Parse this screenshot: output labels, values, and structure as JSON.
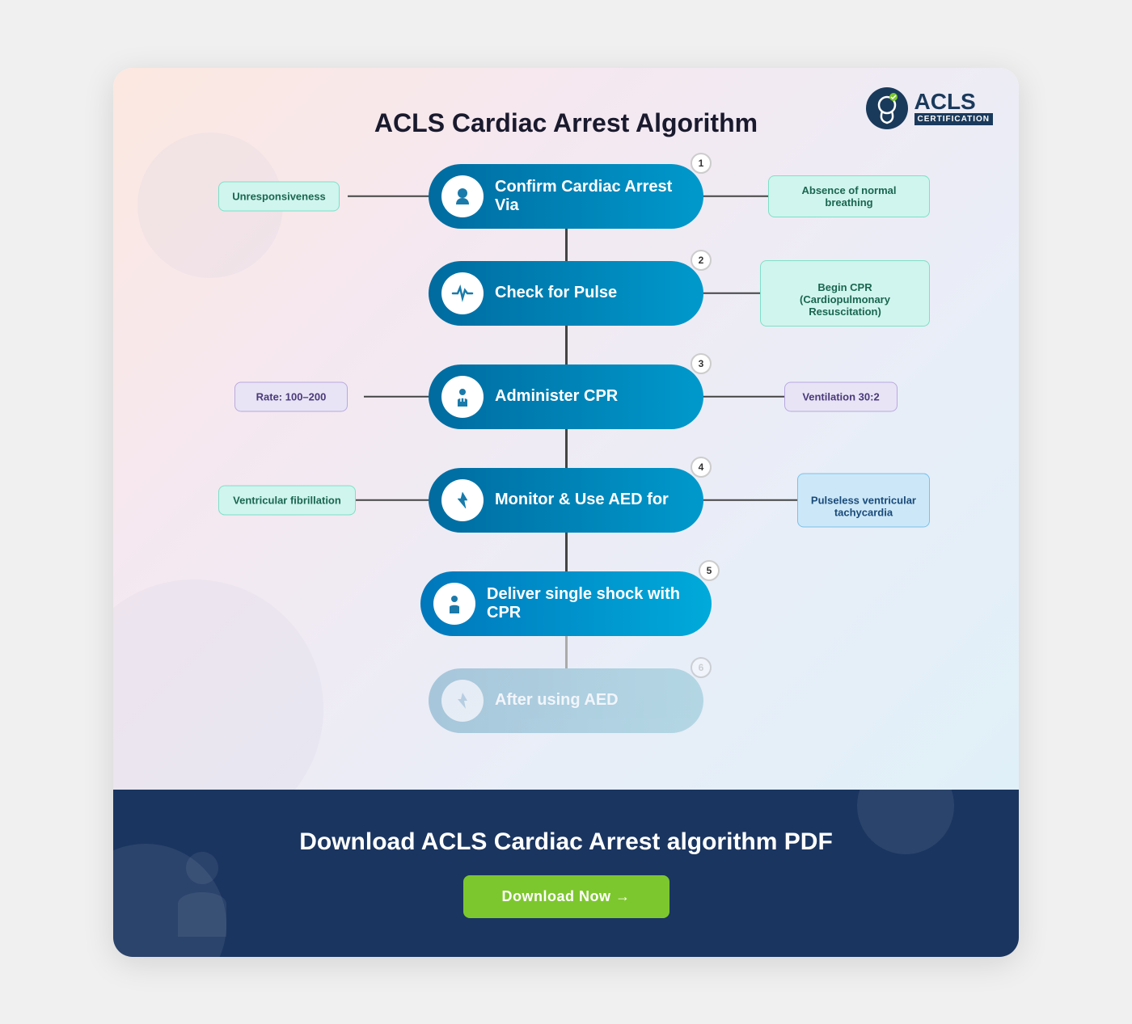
{
  "page": {
    "title": "ACLS Cardiac Arrest Algorithm"
  },
  "logo": {
    "acls": "ACLS",
    "certification": "CERTIFICATION"
  },
  "steps": [
    {
      "num": "1",
      "label": "Confirm Cardiac Arrest Via"
    },
    {
      "num": "2",
      "label": "Check for Pulse"
    },
    {
      "num": "3",
      "label": "Administer CPR"
    },
    {
      "num": "4",
      "label": "Monitor & Use AED for"
    },
    {
      "num": "5",
      "label": "Deliver single shock with CPR"
    },
    {
      "num": "6",
      "label": "After using AED"
    }
  ],
  "sideboxes": {
    "step1_left": "Unresponsiveness",
    "step1_right": "Absence of normal breathing",
    "step2_right": "Begin CPR\n(Cardiopulmonary Resuscitation)",
    "step3_left": "Rate: 100–200",
    "step3_right": "Ventilation 30:2",
    "step4_left": "Ventricular fibrillation",
    "step4_right": "Pulseless ventricular\ntachycardia"
  },
  "download": {
    "title": "Download ACLS Cardiac Arrest algorithm PDF",
    "button_label": "Download Now →"
  }
}
